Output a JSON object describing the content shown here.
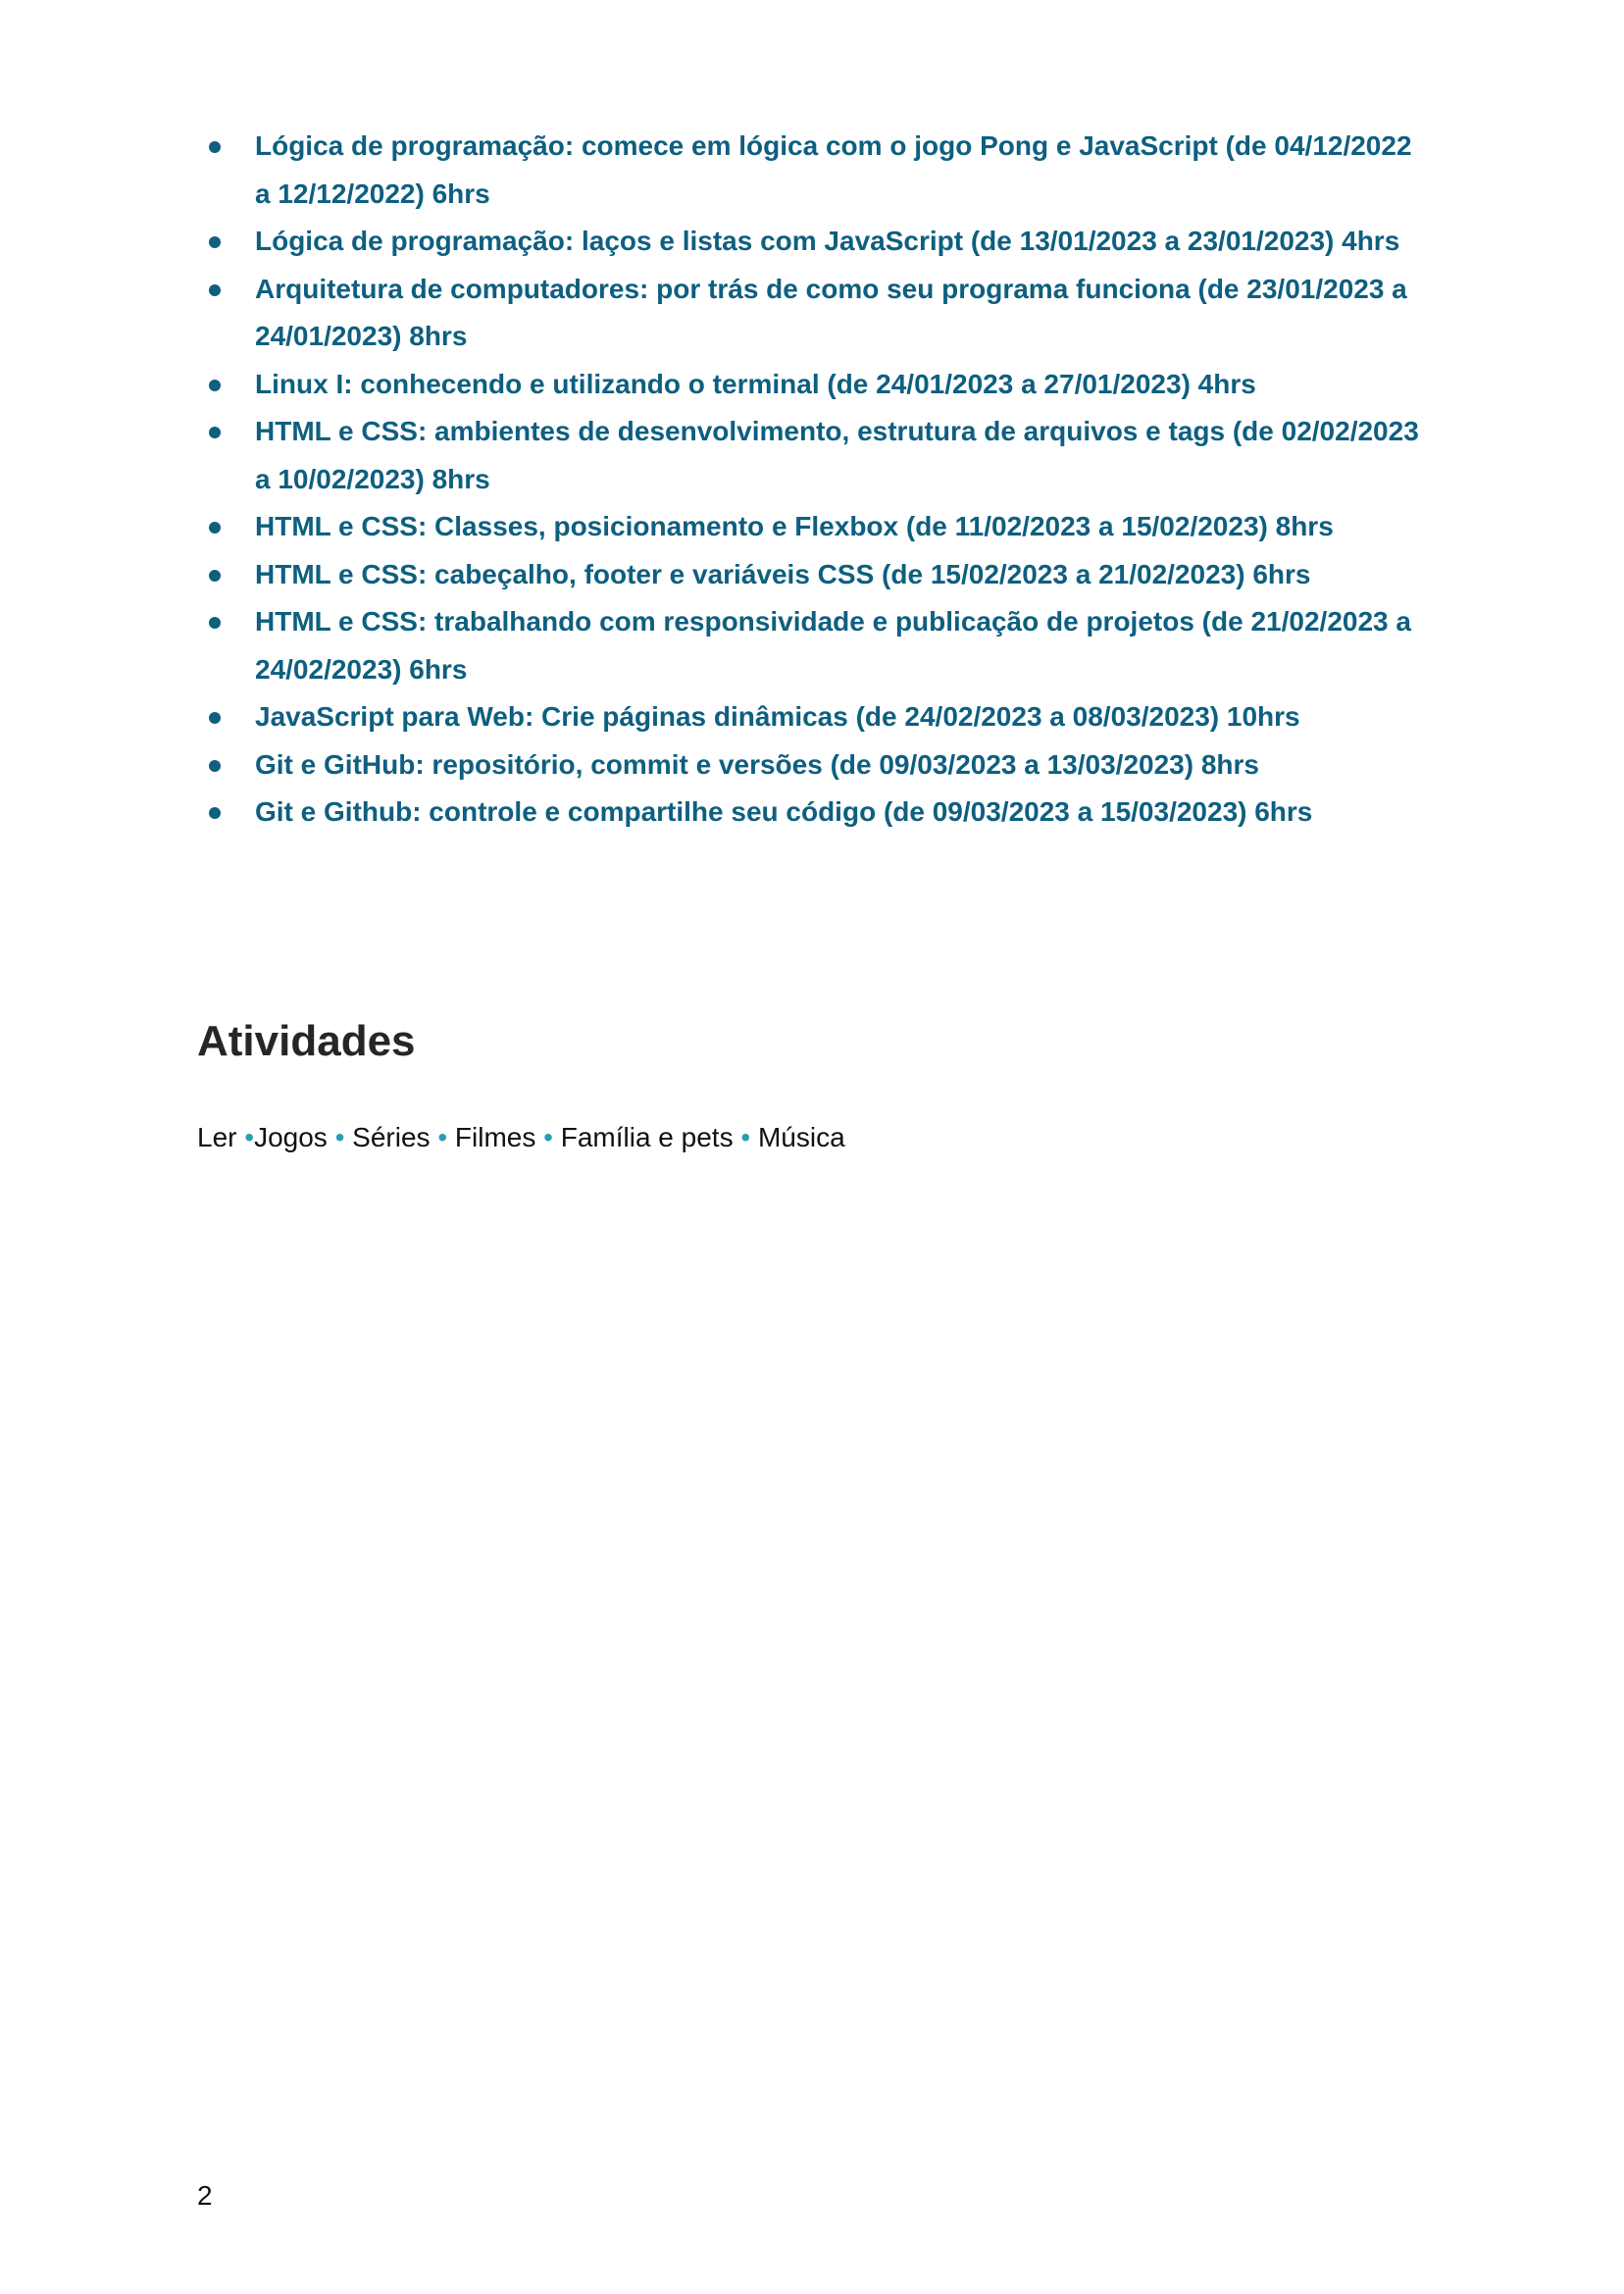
{
  "colors": {
    "course_text": "#0e5f80",
    "activity_bullet": "#2a9bb8",
    "heading": "#262626",
    "body_text": "#111111"
  },
  "courses": [
    "Lógica de programação: comece em lógica com o jogo Pong e JavaScript (de 04/12/2022 a 12/12/2022) 6hrs",
    "Lógica de programação: laços e listas com JavaScript (de 13/01/2023 a 23/01/2023) 4hrs",
    "Arquitetura de computadores: por trás de como seu programa funciona (de 23/01/2023 a 24/01/2023) 8hrs",
    "Linux I: conhecendo e utilizando o terminal (de 24/01/2023 a 27/01/2023) 4hrs",
    "HTML e CSS: ambientes de desenvolvimento, estrutura de arquivos e tags (de 02/02/2023 a 10/02/2023) 8hrs",
    "HTML e CSS: Classes, posicionamento e Flexbox (de 11/02/2023 a 15/02/2023) 8hrs",
    "HTML e CSS: cabeçalho, footer e variáveis CSS (de 15/02/2023 a 21/02/2023) 6hrs",
    "HTML e CSS: trabalhando com responsividade e publicação de projetos (de 21/02/2023 a 24/02/2023) 6hrs",
    "JavaScript para Web: Crie páginas dinâmicas (de 24/02/2023 a 08/03/2023) 10hrs",
    "Git e GitHub: repositório, commit e versões (de 09/03/2023 a 13/03/2023) 8hrs",
    "Git e Github: controle e compartilhe seu código (de 09/03/2023 a 15/03/2023) 6hrs"
  ],
  "activities_section": {
    "title": "Atividades",
    "items": [
      "Ler",
      "Jogos",
      "Séries",
      "Filmes",
      "Família e pets",
      "Música"
    ],
    "separator": "•"
  },
  "page_number": "2"
}
